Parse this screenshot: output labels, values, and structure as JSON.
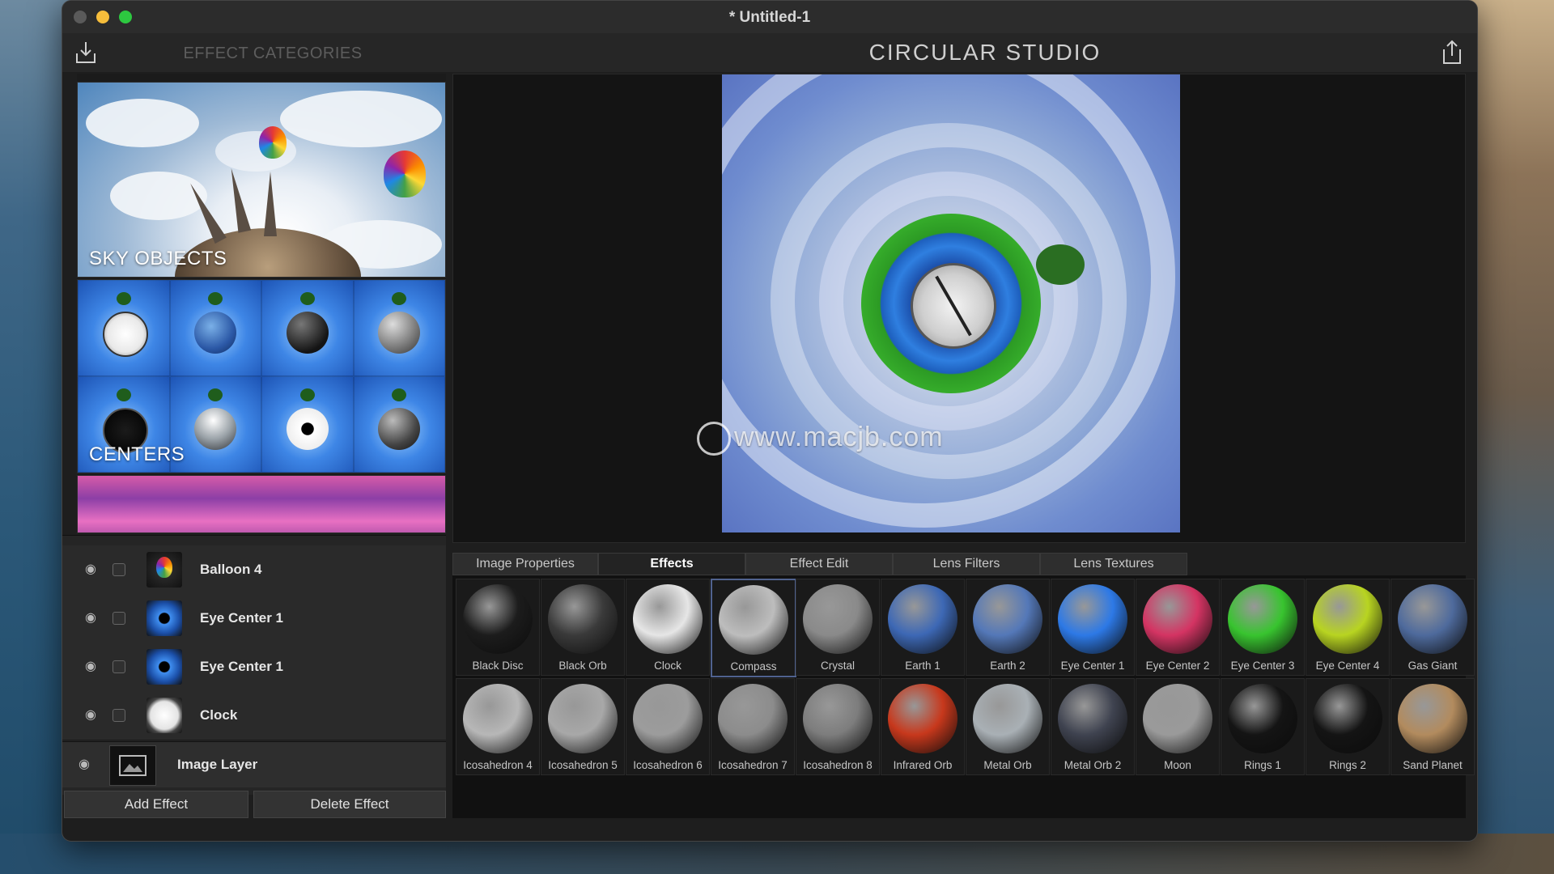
{
  "window": {
    "title": "* Untitled-1"
  },
  "toolbar": {
    "effect_categories_label": "EFFECT CATEGORIES",
    "app_title": "CIRCULAR STUDIO",
    "import_icon": "import-tray-icon",
    "share_icon": "share-icon"
  },
  "categories": [
    {
      "label": "SKY OBJECTS"
    },
    {
      "label": "CENTERS"
    },
    {
      "label": ""
    }
  ],
  "layers": [
    {
      "name": "Balloon 4",
      "thumb": "balloon"
    },
    {
      "name": "Eye Center 1",
      "thumb": "eye-blue"
    },
    {
      "name": "Eye Center 1",
      "thumb": "eye-blue"
    },
    {
      "name": "Clock",
      "thumb": "clock"
    }
  ],
  "image_layer": {
    "name": "Image Layer"
  },
  "buttons": {
    "add_effect": "Add Effect",
    "delete_effect": "Delete Effect"
  },
  "watermark": "www.macjb.com",
  "tabs": [
    {
      "label": "Image Properties",
      "active": false
    },
    {
      "label": "Effects",
      "active": true
    },
    {
      "label": "Effect Edit",
      "active": false
    },
    {
      "label": "Lens Filters",
      "active": false
    },
    {
      "label": "Lens Textures",
      "active": false
    }
  ],
  "effects_row1": [
    {
      "label": "Black Disc",
      "color": "#1c1c1c"
    },
    {
      "label": "Black Orb",
      "color": "#3a3a3a"
    },
    {
      "label": "Clock",
      "color": "#e6e6e6"
    },
    {
      "label": "Compass",
      "color": "#bdbdbd",
      "selected": true
    },
    {
      "label": "Crystal",
      "color": "#8a8a8a"
    },
    {
      "label": "Earth 1",
      "color": "#3d68b5"
    },
    {
      "label": "Earth 2",
      "color": "#5478b8"
    },
    {
      "label": "Eye Center 1",
      "color": "#2d79e6"
    },
    {
      "label": "Eye Center 2",
      "color": "#d43463"
    },
    {
      "label": "Eye Center 3",
      "color": "#38c42f"
    },
    {
      "label": "Eye Center 4",
      "color": "#b8d421"
    },
    {
      "label": "Gas Giant",
      "color": "#4e6a9c"
    }
  ],
  "effects_row2": [
    {
      "label": "Icosahedron 4",
      "color": "#b7b7b7"
    },
    {
      "label": "Icosahedron 5",
      "color": "#a8a8a8"
    },
    {
      "label": "Icosahedron 6",
      "color": "#9c9c9c"
    },
    {
      "label": "Icosahedron 7",
      "color": "#8c8c8c"
    },
    {
      "label": "Icosahedron 8",
      "color": "#7d7d7d"
    },
    {
      "label": "Infrared Orb",
      "color": "#c7381c"
    },
    {
      "label": "Metal Orb",
      "color": "#a9b0b5"
    },
    {
      "label": "Metal Orb 2",
      "color": "#3f4350"
    },
    {
      "label": "Moon",
      "color": "#9a9a9a"
    },
    {
      "label": "Rings 1",
      "color": "#141414"
    },
    {
      "label": "Rings 2",
      "color": "#141414"
    },
    {
      "label": "Sand Planet",
      "color": "#b28b5e"
    }
  ]
}
